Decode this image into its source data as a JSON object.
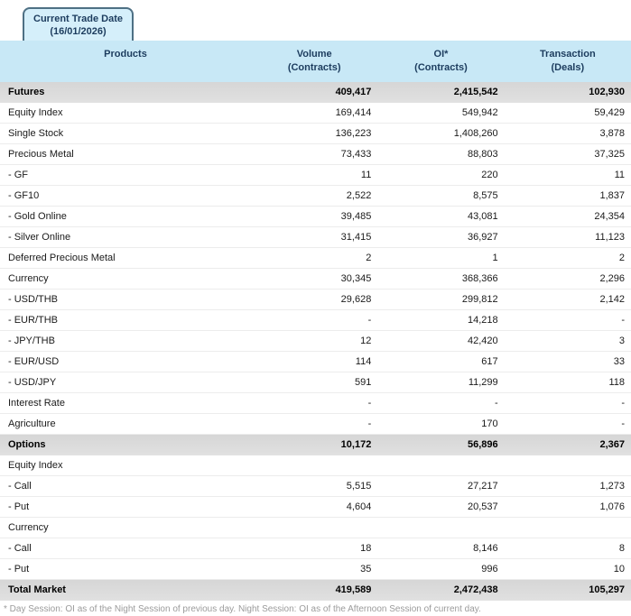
{
  "tab": {
    "line1": "Current Trade Date",
    "line2": "(16/01/2026)"
  },
  "table": {
    "columns": [
      {
        "label": "Products",
        "sublabel": ""
      },
      {
        "label": "Volume",
        "sublabel": "(Contracts)"
      },
      {
        "label": "OI*",
        "sublabel": "(Contracts)"
      },
      {
        "label": "Transaction",
        "sublabel": "(Deals)"
      }
    ],
    "rows": [
      {
        "product": "Futures",
        "volume": "409,417",
        "oi": "2,415,542",
        "transaction": "102,930",
        "emphasis": true
      },
      {
        "product": "Equity Index",
        "volume": "169,414",
        "oi": "549,942",
        "transaction": "59,429",
        "emphasis": false
      },
      {
        "product": "Single Stock",
        "volume": "136,223",
        "oi": "1,408,260",
        "transaction": "3,878",
        "emphasis": false
      },
      {
        "product": "Precious Metal",
        "volume": "73,433",
        "oi": "88,803",
        "transaction": "37,325",
        "emphasis": false
      },
      {
        "product": "- GF",
        "volume": "11",
        "oi": "220",
        "transaction": "11",
        "emphasis": false
      },
      {
        "product": "- GF10",
        "volume": "2,522",
        "oi": "8,575",
        "transaction": "1,837",
        "emphasis": false
      },
      {
        "product": "- Gold Online",
        "volume": "39,485",
        "oi": "43,081",
        "transaction": "24,354",
        "emphasis": false
      },
      {
        "product": "- Silver Online",
        "volume": "31,415",
        "oi": "36,927",
        "transaction": "11,123",
        "emphasis": false
      },
      {
        "product": "Deferred Precious Metal",
        "volume": "2",
        "oi": "1",
        "transaction": "2",
        "emphasis": false
      },
      {
        "product": "Currency",
        "volume": "30,345",
        "oi": "368,366",
        "transaction": "2,296",
        "emphasis": false
      },
      {
        "product": "- USD/THB",
        "volume": "29,628",
        "oi": "299,812",
        "transaction": "2,142",
        "emphasis": false
      },
      {
        "product": "- EUR/THB",
        "volume": "-",
        "oi": "14,218",
        "transaction": "-",
        "emphasis": false
      },
      {
        "product": "- JPY/THB",
        "volume": "12",
        "oi": "42,420",
        "transaction": "3",
        "emphasis": false
      },
      {
        "product": "- EUR/USD",
        "volume": "114",
        "oi": "617",
        "transaction": "33",
        "emphasis": false
      },
      {
        "product": "- USD/JPY",
        "volume": "591",
        "oi": "11,299",
        "transaction": "118",
        "emphasis": false
      },
      {
        "product": "Interest Rate",
        "volume": "-",
        "oi": "-",
        "transaction": "-",
        "emphasis": false
      },
      {
        "product": "Agriculture",
        "volume": "-",
        "oi": "170",
        "transaction": "-",
        "emphasis": false
      },
      {
        "product": "Options",
        "volume": "10,172",
        "oi": "56,896",
        "transaction": "2,367",
        "emphasis": true
      },
      {
        "product": "Equity Index",
        "volume": "",
        "oi": "",
        "transaction": "",
        "emphasis": false
      },
      {
        "product": "- Call",
        "volume": "5,515",
        "oi": "27,217",
        "transaction": "1,273",
        "emphasis": false
      },
      {
        "product": "- Put",
        "volume": "4,604",
        "oi": "20,537",
        "transaction": "1,076",
        "emphasis": false
      },
      {
        "product": "Currency",
        "volume": "",
        "oi": "",
        "transaction": "",
        "emphasis": false
      },
      {
        "product": "- Call",
        "volume": "18",
        "oi": "8,146",
        "transaction": "8",
        "emphasis": false
      },
      {
        "product": "- Put",
        "volume": "35",
        "oi": "996",
        "transaction": "10",
        "emphasis": false
      },
      {
        "product": "Total Market",
        "volume": "419,589",
        "oi": "2,472,438",
        "transaction": "105,297",
        "emphasis": true
      }
    ]
  },
  "footnote": "* Day Session: OI as of the Night Session of previous day. Night Session: OI as of the Afternoon Session of current day.",
  "colors": {
    "header_bg": "#c8e8f6",
    "tab_bg": "#d5effa",
    "tab_border": "#4e7084",
    "navy_text": "#1c3c5e",
    "total_row_bg": "#dcdcdc",
    "footnote_text": "#9b9b9b",
    "bottom_line": "#c4e5f2"
  }
}
